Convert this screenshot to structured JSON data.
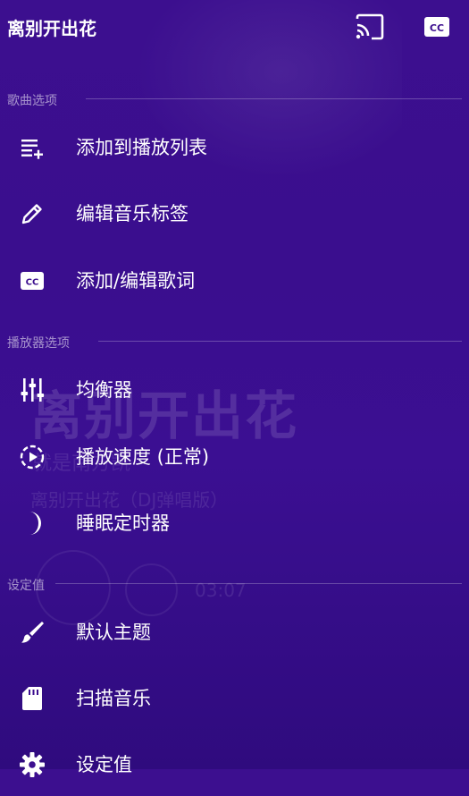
{
  "header": {
    "title": "离别开出花",
    "cast_icon": "cast-icon",
    "cc_icon": "closed-caption-icon"
  },
  "sections": [
    {
      "header": "歌曲选项",
      "items": [
        {
          "label": "添加到播放列表",
          "icon": "playlist-add-icon"
        },
        {
          "label": "编辑音乐标签",
          "icon": "pencil-icon"
        },
        {
          "label": "添加/编辑歌词",
          "icon": "closed-caption-icon"
        }
      ]
    },
    {
      "header": "播放器选项",
      "items": [
        {
          "label": "均衡器",
          "icon": "equalizer-icon"
        },
        {
          "label": "播放速度 (正常)",
          "icon": "playback-speed-icon"
        },
        {
          "label": "睡眠定时器",
          "icon": "moon-icon"
        }
      ]
    },
    {
      "header": "设定值",
      "items": [
        {
          "label": "默认主题",
          "icon": "brush-icon"
        },
        {
          "label": "扫描音乐",
          "icon": "sd-card-icon"
        },
        {
          "label": "设定值",
          "icon": "gear-icon"
        }
      ]
    }
  ],
  "background": {
    "song_title": "离别开出花",
    "song_subtitle": "就是南方凯",
    "song_version": "离别开出花（DJ弹唱版）",
    "time": "03:07"
  },
  "colors": {
    "background": "#3c0f8f",
    "text": "#ffffff"
  }
}
